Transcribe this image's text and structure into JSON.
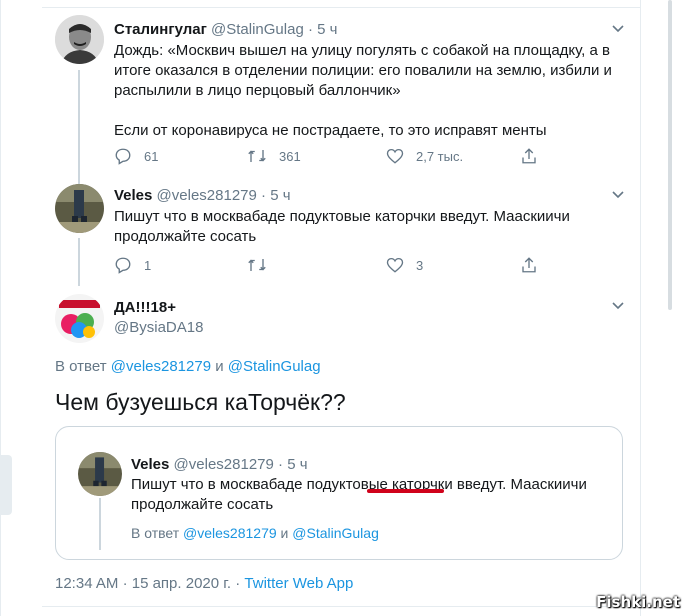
{
  "tweet1": {
    "name": "Сталингулаг",
    "handle": "@StalinGulag",
    "dot": "·",
    "time": "5 ч",
    "lines": [
      "Дождь: «Москвич вышел на улицу погулять с собакой на площадку, а в",
      "итоге оказался в отделении полиции: его повалили на землю, избили и",
      "распылили в лицо перцовый баллончик»",
      "",
      "Если от коронавируса не пострадаете, то это исправят менты"
    ],
    "replies": "61",
    "retweets": "361",
    "likes": "2,7 тыс."
  },
  "tweet2": {
    "name": "Veles",
    "handle": "@veles281279",
    "dot": "·",
    "time": "5 ч",
    "lines": [
      "Пишут что в москвабаде подуктовые каторчки введут.  Мааскиичи",
      "продолжайте сосать"
    ],
    "replies": "1",
    "retweets": "",
    "likes": "3"
  },
  "tweet3": {
    "name": "ДА!!!18+",
    "handle": "@BysiaDA18",
    "reply_prefix": "В ответ",
    "reply_user1": "@veles281279",
    "reply_and": "и",
    "reply_user2": "@StalinGulag",
    "text": "Чем бузуешься каТорчёк??"
  },
  "quoted": {
    "name": "Veles",
    "handle": "@veles281279",
    "dot": "·",
    "time": "5 ч",
    "lines": [
      "Пишут что в москвабаде подуктовые каторчки введут.  Мааскиичи",
      "продолжайте сосать"
    ],
    "reply_prefix": "В ответ",
    "reply_user1": "@veles281279",
    "reply_and": "и",
    "reply_user2": "@StalinGulag"
  },
  "footer": {
    "time": "12:34 AM",
    "dot1": "·",
    "date": "15 апр. 2020 г.",
    "dot2": "·",
    "app": "Twitter Web App"
  },
  "watermark": "Fishki.net",
  "colors": {
    "link": "#1b95e0",
    "muted": "#657786",
    "text": "#14171a",
    "underline": "#d0021b",
    "border": "#ccd6dd"
  },
  "icons": {
    "reply": "reply-icon",
    "retweet": "retweet-icon",
    "like": "heart-icon",
    "share": "share-icon",
    "more": "chevron-down-icon"
  }
}
